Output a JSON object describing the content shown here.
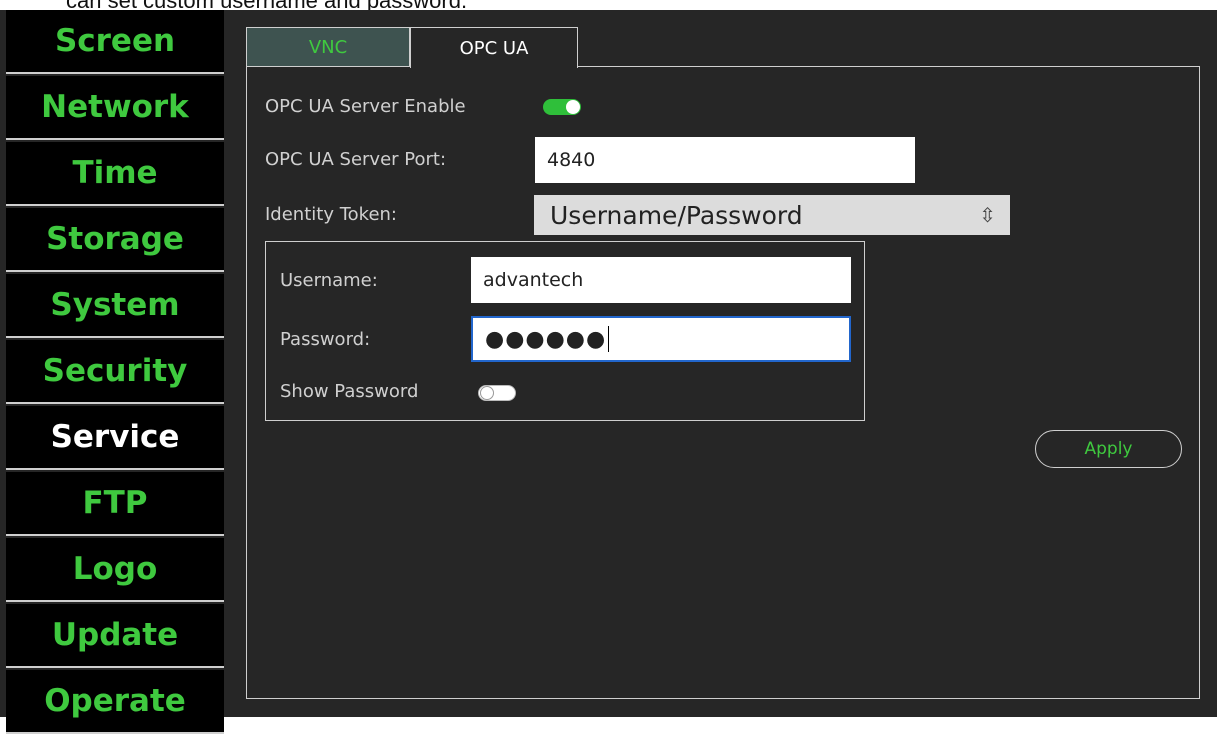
{
  "caption": "can set custom username and password.",
  "sidebar": {
    "items": [
      {
        "label": "Screen"
      },
      {
        "label": "Network"
      },
      {
        "label": "Time"
      },
      {
        "label": "Storage"
      },
      {
        "label": "System"
      },
      {
        "label": "Security"
      },
      {
        "label": "Service",
        "active": true
      },
      {
        "label": "FTP"
      },
      {
        "label": "Logo"
      },
      {
        "label": "Update"
      },
      {
        "label": "Operate"
      }
    ]
  },
  "tabs": {
    "vnc": "VNC",
    "opcua": "OPC UA",
    "selected": "OPC UA"
  },
  "form": {
    "server_enable_label": "OPC UA Server Enable",
    "server_enable": true,
    "port_label": "OPC UA Server Port:",
    "port_value": "4840",
    "identity_label": "Identity Token:",
    "identity_value": "Username/Password",
    "username_label": "Username:",
    "username_value": "advantech",
    "password_label": "Password:",
    "password_masked": "●●●●●●",
    "show_password_label": "Show Password",
    "show_password": false,
    "apply_label": "Apply"
  },
  "colors": {
    "accent_green": "#3fc93f",
    "toggle_on": "#2fbf3a",
    "background": "#262626",
    "sidebar_bg": "#000000",
    "vnc_tab_bg": "#3e5350"
  }
}
